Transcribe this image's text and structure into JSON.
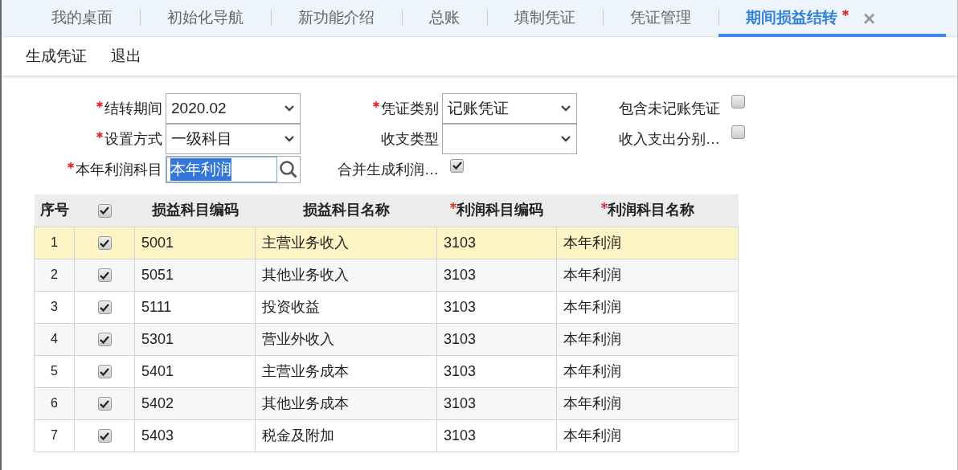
{
  "tabs": [
    {
      "label": "我的桌面",
      "selected": false,
      "modified": false
    },
    {
      "label": "初始化导航",
      "selected": false,
      "modified": false
    },
    {
      "label": "新功能介绍",
      "selected": false,
      "modified": false
    },
    {
      "label": "总账",
      "selected": false,
      "modified": false
    },
    {
      "label": "填制凭证",
      "selected": false,
      "modified": false
    },
    {
      "label": "凭证管理",
      "selected": false,
      "modified": false
    },
    {
      "label": "期间损益结转",
      "selected": true,
      "modified": true
    }
  ],
  "tab_close": "×",
  "toolbar": [
    "生成凭证",
    "退出"
  ],
  "form": {
    "rows": [
      [
        {
          "kind": "select",
          "label": "结转期间",
          "required": true,
          "value": "2020.02"
        },
        {
          "kind": "select",
          "label": "凭证类别",
          "required": true,
          "value": "记账凭证"
        },
        {
          "kind": "checkbox",
          "label": "包含未记账凭证",
          "checked": false
        }
      ],
      [
        {
          "kind": "select",
          "label": "设置方式",
          "required": true,
          "value": "一级科目"
        },
        {
          "kind": "select",
          "label": "收支类型",
          "required": false
        },
        {
          "kind": "checkbox",
          "label": "收入支出分别…",
          "checked": false
        }
      ],
      [
        {
          "kind": "lookup",
          "label": "本年利润科目",
          "required": true,
          "value": "本年利润",
          "highlighted": true
        },
        {
          "kind": "checkbox",
          "label": "合并生成利润…",
          "checked": true
        }
      ]
    ]
  },
  "table": {
    "columns": [
      {
        "kind": "text",
        "label": "序号",
        "required": false
      },
      {
        "kind": "checkbox",
        "checked": true
      },
      {
        "kind": "text",
        "label": "损益科目编码",
        "required": false
      },
      {
        "kind": "text",
        "label": "损益科目名称",
        "required": false
      },
      {
        "kind": "text",
        "label": "利润科目编码",
        "required": true
      },
      {
        "kind": "text",
        "label": "利润科目名称",
        "required": true
      }
    ],
    "rows": [
      {
        "no": "1",
        "checked": true,
        "code": "5001",
        "name": "主营业务收入",
        "profit_code": "3103",
        "profit_name": "本年利润",
        "selected": true
      },
      {
        "no": "2",
        "checked": true,
        "code": "5051",
        "name": "其他业务收入",
        "profit_code": "3103",
        "profit_name": "本年利润",
        "selected": false
      },
      {
        "no": "3",
        "checked": true,
        "code": "5111",
        "name": "投资收益",
        "profit_code": "3103",
        "profit_name": "本年利润",
        "selected": false
      },
      {
        "no": "4",
        "checked": true,
        "code": "5301",
        "name": "营业外收入",
        "profit_code": "3103",
        "profit_name": "本年利润",
        "selected": false
      },
      {
        "no": "5",
        "checked": true,
        "code": "5401",
        "name": "主营业务成本",
        "profit_code": "3103",
        "profit_name": "本年利润",
        "selected": false
      },
      {
        "no": "6",
        "checked": true,
        "code": "5402",
        "name": "其他业务成本",
        "profit_code": "3103",
        "profit_name": "本年利润",
        "selected": false
      },
      {
        "no": "7",
        "checked": true,
        "code": "5403",
        "name": "税金及附加",
        "profit_code": "3103",
        "profit_name": "本年利润",
        "selected": false
      }
    ]
  }
}
